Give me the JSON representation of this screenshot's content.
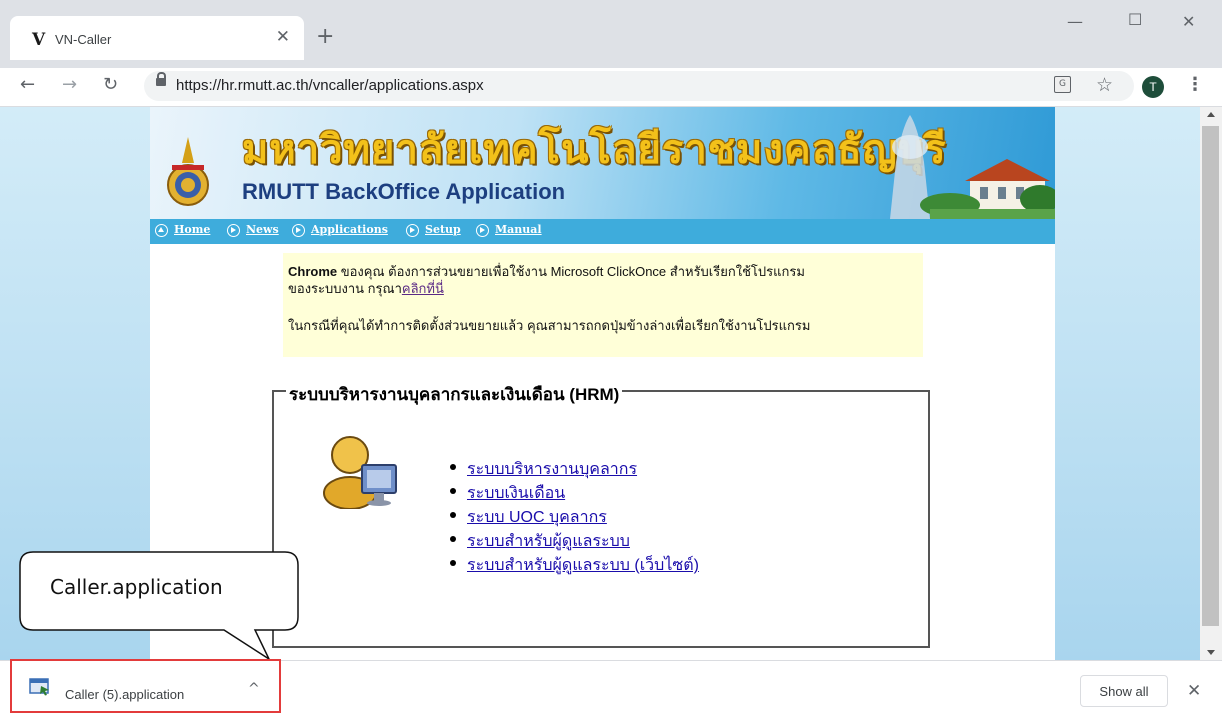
{
  "browser": {
    "tab_title": "VN-Caller",
    "tab_favicon": "V",
    "url": "https://hr.rmutt.ac.th/vncaller/applications.aspx",
    "profile_initial": "T"
  },
  "banner": {
    "thai_title": "มหาวิทยาลัยเทคโนโลยีราชมงคลธัญบุรี",
    "english_title": "RMUTT BackOffice Application"
  },
  "nav": {
    "home": "Home",
    "news": "News",
    "applications": "Applications",
    "setup": "Setup",
    "manual": "Manual"
  },
  "notice": {
    "browser_name": "Chrome",
    "line1_rest": " ของคุณ ต้องการส่วนขยายเพื่อใช้งาน Microsoft ClickOnce สำหรับเรียกใช้โปรแกรม",
    "line2_prefix": "ของระบบงาน กรุณา",
    "link": "คลิกที่นี่",
    "line3": "ในกรณีที่คุณได้ทำการติดตั้งส่วนขยายแล้ว คุณสามารถกดปุ่มข้างล่างเพื่อเรียกใช้งานโปรแกรม"
  },
  "hrm": {
    "legend": "ระบบบริหารงานบุคลากรและเงินเดือน (HRM)",
    "links": [
      "ระบบบริหารงานบุคลากร",
      "ระบบเงินเดือน",
      "ระบบ UOC บุคลากร",
      "ระบบสำหรับผู้ดูแลระบบ",
      "ระบบสำหรับผู้ดูแลระบบ (เว็บไซต์)"
    ]
  },
  "downloads": {
    "file_name": "Caller (5).application",
    "show_all": "Show all"
  },
  "callout": {
    "text": "Caller.application"
  },
  "colors": {
    "nav_blue": "#3eacdc",
    "notice_bg": "#ffffd8",
    "highlight_red": "#e33b3b",
    "title_gold": "#f3c11a"
  }
}
